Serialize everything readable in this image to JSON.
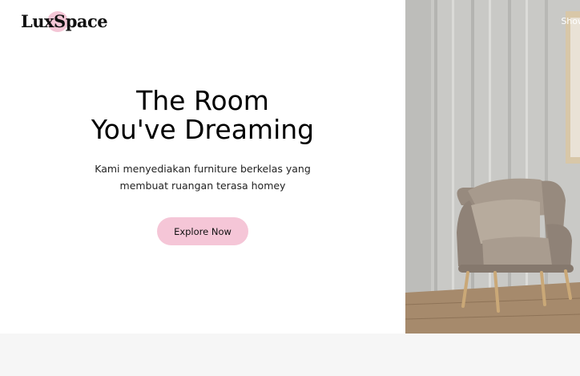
{
  "brand": {
    "name": "LuxSpace"
  },
  "nav": {
    "right_link": "Show"
  },
  "hero": {
    "title_line1": "The Room",
    "title_line2": "You've Dreaming",
    "subtitle_line1": "Kami menyediakan furniture berkelas yang",
    "subtitle_line2": "membuat ruangan terasa homey",
    "cta_label": "Explore Now"
  },
  "colors": {
    "accent_pink": "#f5c6d7",
    "text_dark": "#111111",
    "footer_band": "#f6f6f6"
  },
  "image": {
    "subject": "armchair-photo"
  }
}
